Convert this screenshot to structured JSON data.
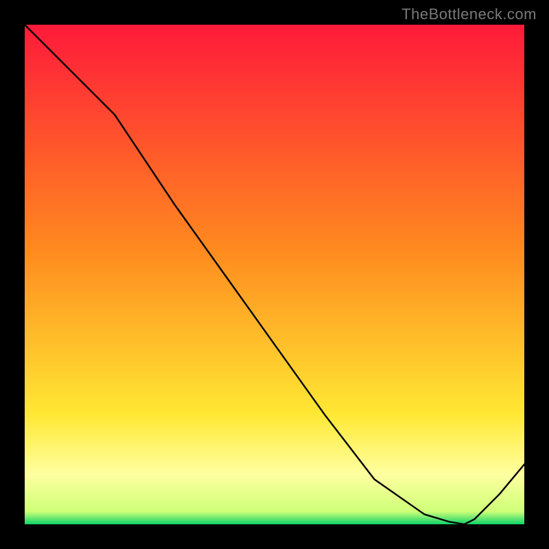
{
  "watermark": "TheBottleneck.com",
  "chart_data": {
    "type": "line",
    "title": "",
    "xlabel": "",
    "ylabel": "",
    "x": [
      0.0,
      0.08,
      0.1,
      0.12,
      0.14,
      0.16,
      0.18,
      0.2,
      0.22,
      0.24,
      0.3,
      0.4,
      0.5,
      0.6,
      0.7,
      0.8,
      0.85,
      0.88,
      0.9,
      0.95,
      1.0
    ],
    "values": [
      1.0,
      0.92,
      0.9,
      0.88,
      0.86,
      0.84,
      0.82,
      0.79,
      0.76,
      0.73,
      0.64,
      0.5,
      0.36,
      0.22,
      0.09,
      0.02,
      0.005,
      0.0,
      0.01,
      0.06,
      0.12
    ],
    "xlim": [
      0,
      1
    ],
    "ylim": [
      0,
      1
    ],
    "minimum_x": 0.85,
    "gradient_stops": [
      {
        "y": 0.0,
        "color": "#ff1a3a"
      },
      {
        "y": 0.45,
        "color": "#ff8a1f"
      },
      {
        "y": 0.78,
        "color": "#ffe833"
      },
      {
        "y": 0.9,
        "color": "#ffffa0"
      },
      {
        "y": 0.975,
        "color": "#ceff78"
      },
      {
        "y": 1.0,
        "color": "#14d468"
      }
    ]
  },
  "minimum_label": ""
}
